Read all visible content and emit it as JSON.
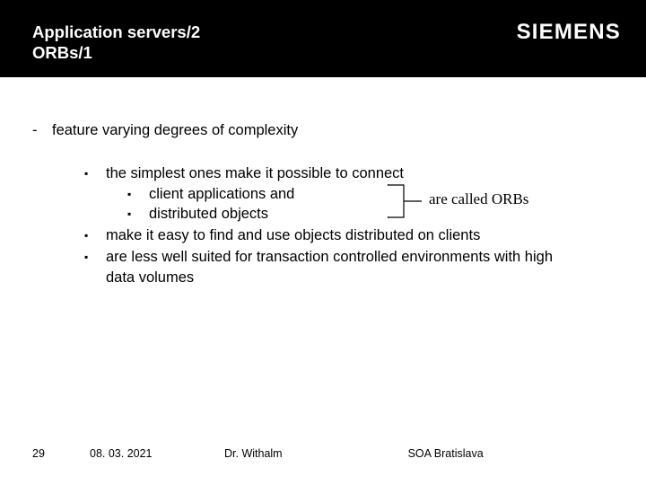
{
  "header": {
    "title_line1": "Application servers/2",
    "title_line2": "ORBs/1",
    "brand": "SIEMENS"
  },
  "bullets": {
    "level0": "feature varying degrees of complexity",
    "level1": [
      {
        "text": "the simplest ones make it possible to connect",
        "children": [
          "client applications and",
          "distributed objects"
        ]
      },
      {
        "text": "make it easy to find and use objects distributed on clients"
      },
      {
        "text": "are less well suited for transaction controlled environments with high data volumes"
      }
    ],
    "annotation": "are called ORBs"
  },
  "glyphs": {
    "dash": "-",
    "square": "▪"
  },
  "footer": {
    "page": "29",
    "date": "08. 03. 2021",
    "author": "Dr. Withalm",
    "footer": "SOA Bratislava"
  }
}
